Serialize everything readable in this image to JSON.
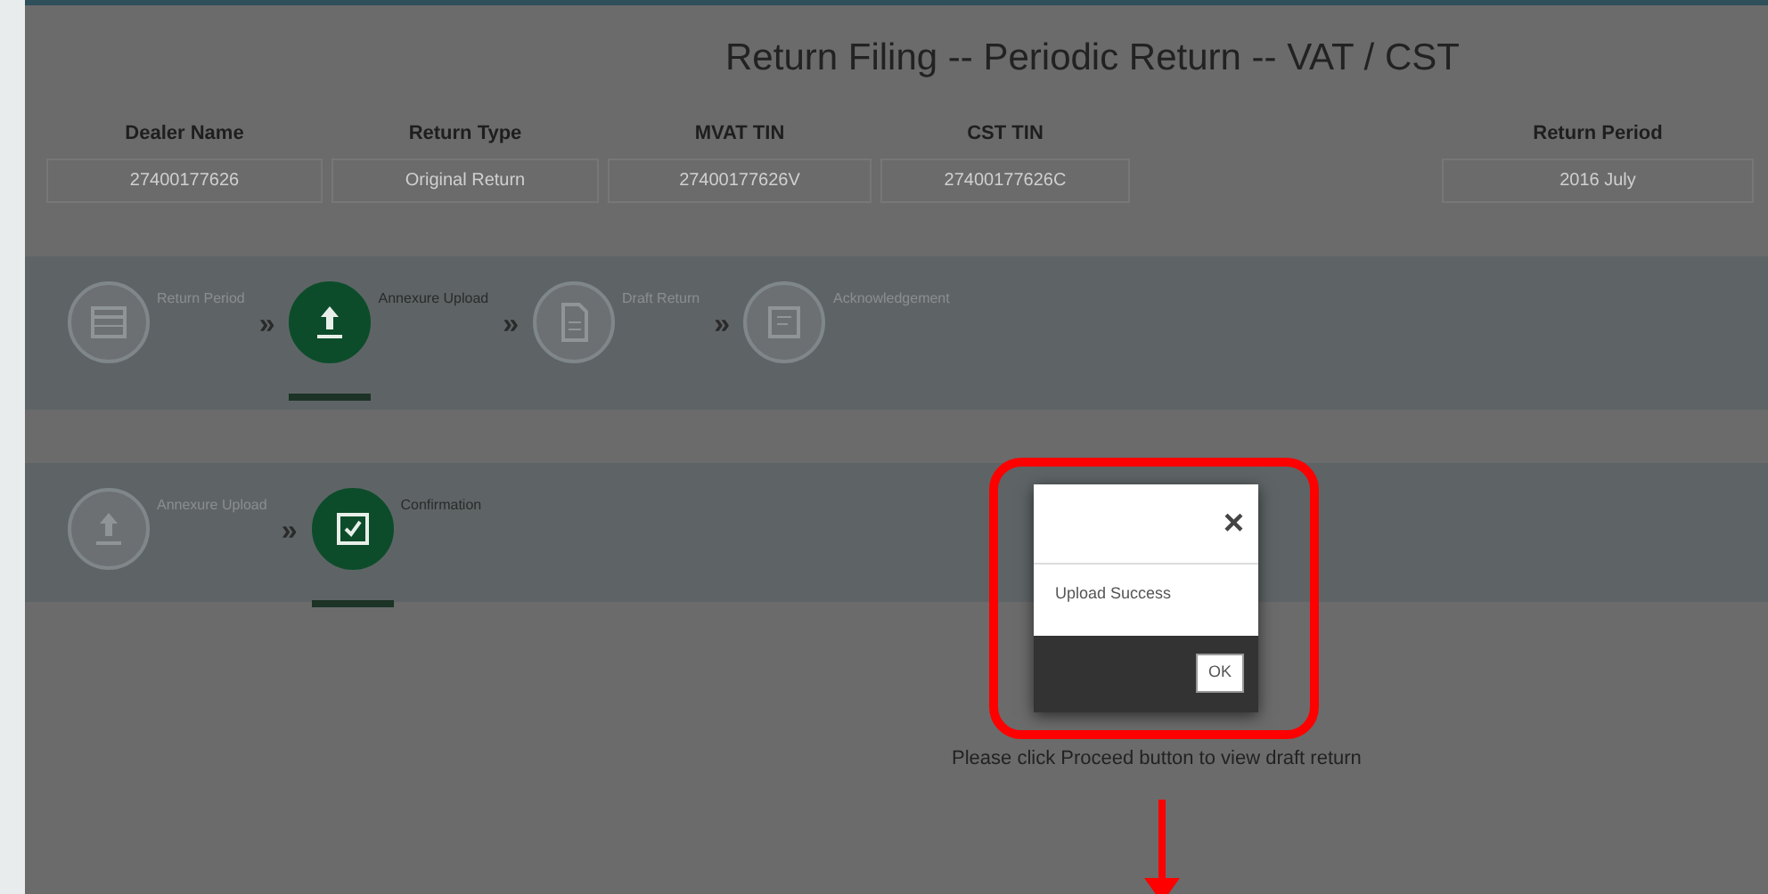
{
  "title": "Return Filing -- Periodic Return -- VAT / CST",
  "header_fields": [
    {
      "label": "Dealer Name",
      "value": "27400177626"
    },
    {
      "label": "Return Type",
      "value": "Original Return"
    },
    {
      "label": "MVAT TIN",
      "value": "27400177626V"
    },
    {
      "label": "CST TIN",
      "value": "27400177626C"
    },
    {
      "label": "Return Period",
      "value": "2016 July"
    }
  ],
  "main_steps": [
    {
      "label": "Return Period",
      "kind": "calendar",
      "selected": false
    },
    {
      "separator": "»",
      "label": "Annexure Upload",
      "kind": "upload",
      "selected": true
    },
    {
      "separator": "»",
      "label": "Draft Return",
      "kind": "document",
      "selected": false
    },
    {
      "separator": "»",
      "label": "Acknowledgement",
      "kind": "receipt",
      "selected": false
    }
  ],
  "sub_steps": [
    {
      "label": "Annexure Upload",
      "kind": "upload",
      "selected": false
    },
    {
      "separator": "»",
      "label": "Confirmation",
      "kind": "check",
      "selected": true
    }
  ],
  "message": "Please click Proceed button to view draft return",
  "dialog": {
    "close": "×",
    "text": "Upload Success",
    "button": "OK"
  }
}
